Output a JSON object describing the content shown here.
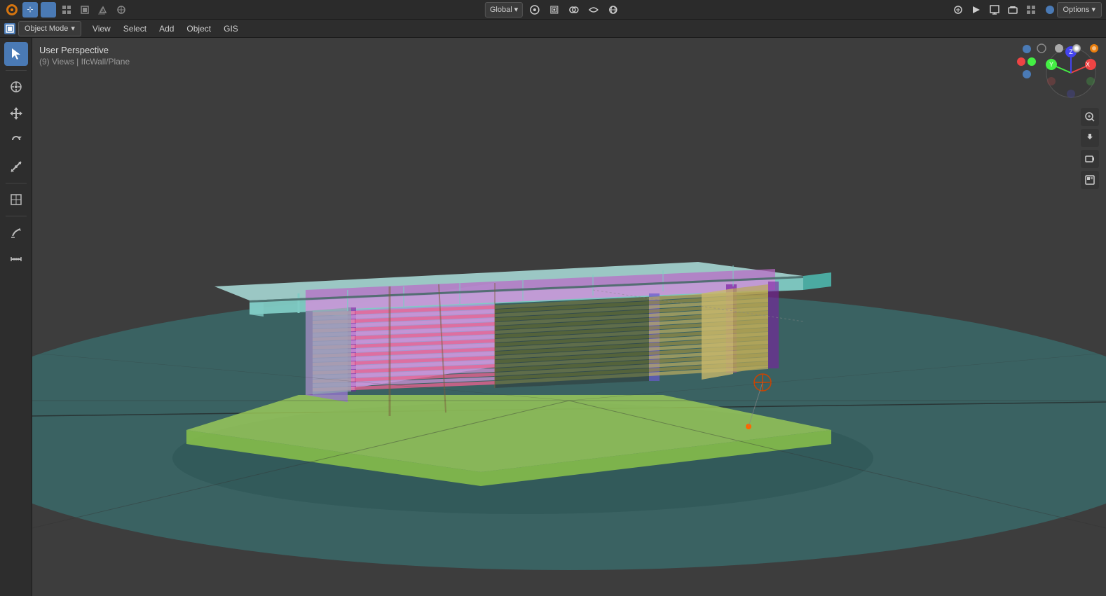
{
  "header": {
    "title": "Blender",
    "options_label": "Options ▾",
    "top_icons": [
      "cursor",
      "box-select",
      "lasso-select",
      "circle-select",
      "transform",
      "rotate",
      "scale"
    ],
    "center_items": [
      {
        "label": "Global",
        "type": "dropdown"
      },
      {
        "label": "🔗",
        "type": "icon"
      },
      {
        "label": "⊞",
        "type": "icon"
      },
      {
        "label": "∧",
        "type": "icon"
      }
    ]
  },
  "menubar": {
    "mode_label": "Object Mode",
    "items": [
      "View",
      "Select",
      "Add",
      "Object",
      "GIS"
    ]
  },
  "viewport": {
    "view_name": "User Perspective",
    "view_sub": "(9) Views | IfcWall/Plane"
  },
  "left_toolbar": {
    "tools": [
      {
        "name": "select",
        "icon": "▶",
        "active": true
      },
      {
        "name": "cursor",
        "icon": "⊕"
      },
      {
        "name": "move",
        "icon": "✛"
      },
      {
        "name": "rotate",
        "icon": "↻"
      },
      {
        "name": "scale",
        "icon": "⤡"
      },
      {
        "name": "transform",
        "icon": "⊞"
      },
      {
        "name": "annotate",
        "icon": "✏"
      },
      {
        "name": "measure",
        "icon": "📏"
      }
    ]
  },
  "gizmo": {
    "x_label": "X",
    "y_label": "Y",
    "z_label": "Z"
  },
  "viewport_right_icons": [
    {
      "name": "zoom",
      "icon": "🔍"
    },
    {
      "name": "pan",
      "icon": "✋"
    },
    {
      "name": "camera",
      "icon": "🎬"
    },
    {
      "name": "render",
      "icon": "⊞"
    }
  ]
}
